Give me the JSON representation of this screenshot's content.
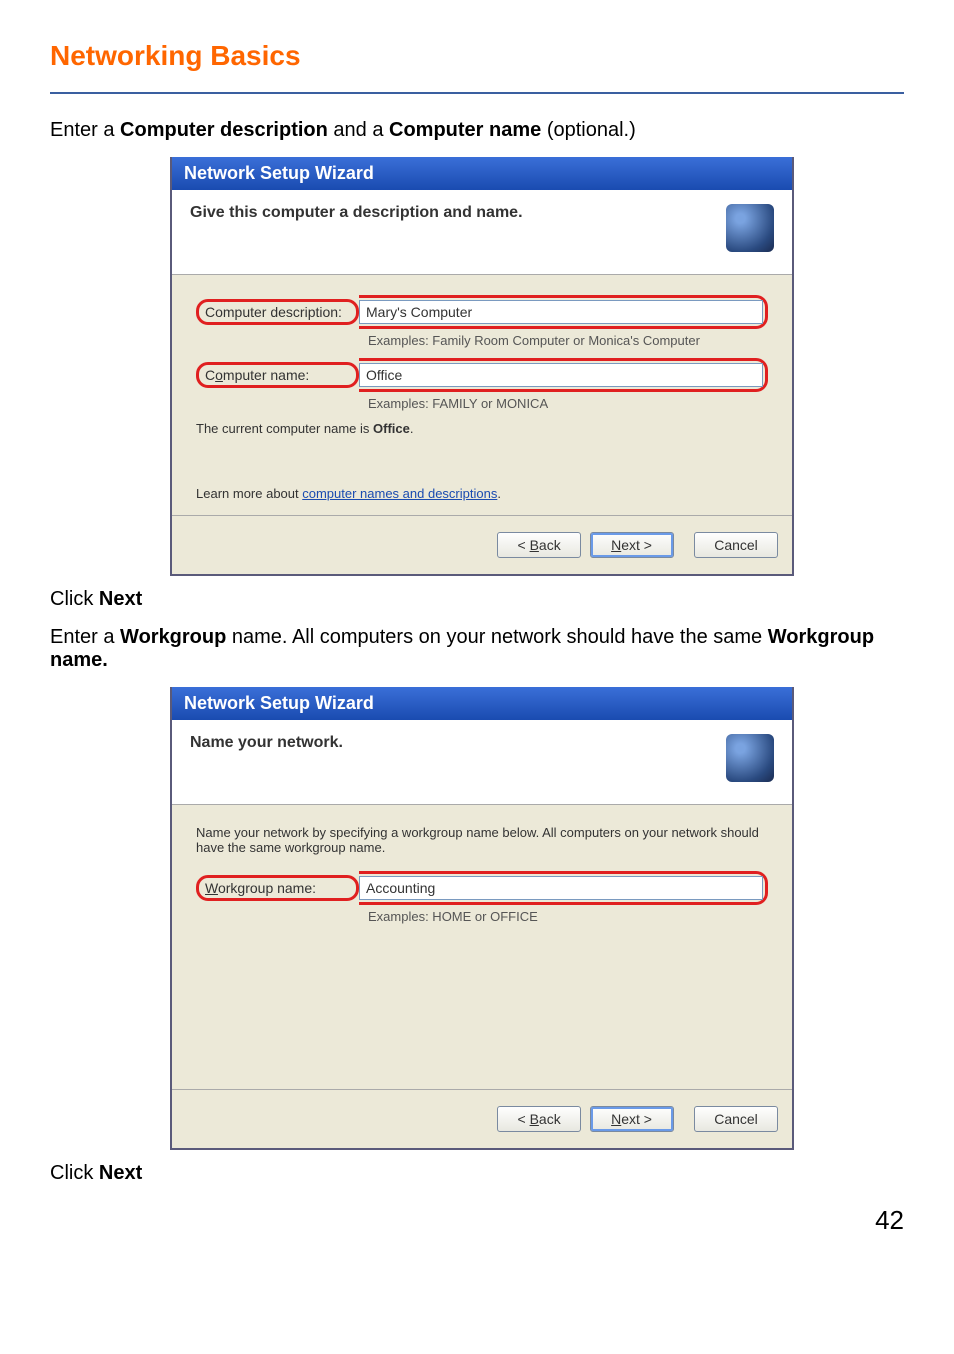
{
  "heading": "Networking Basics",
  "instr1_pre": "Enter a ",
  "instr1_b1": "Computer description",
  "instr1_mid": " and a ",
  "instr1_b2": "Computer name",
  "instr1_post": " (optional.)",
  "wiz1": {
    "title": "Network Setup Wizard",
    "header_text": "Give this computer a description and name.",
    "row1_label": "Computer description:",
    "row1_value": "Mary's Computer",
    "row1_examples": "Examples: Family Room Computer or Monica's Computer",
    "row2_label": "Computer name:",
    "row2_label_under": "o",
    "row2_value": "Office",
    "row2_examples": "Examples: FAMILY or MONICA",
    "current_sentence_pre": "The current computer name is ",
    "current_sentence_val": "Office",
    "learn_pre": "Learn more about ",
    "learn_link": "computer names and descriptions",
    "btn_back": "< Back",
    "btn_back_under": "B",
    "btn_next": "Next >",
    "btn_next_under": "N",
    "btn_cancel": "Cancel"
  },
  "click_next": "Click ",
  "click_next_b": "Next",
  "instr2_pre": "Enter a ",
  "instr2_b1": "Workgroup",
  "instr2_mid": " name.  All computers on your network should have the same ",
  "instr2_b2": "Workgroup name.",
  "wiz2": {
    "title": "Network Setup Wizard",
    "header_text": "Name your network.",
    "body_text": "Name your network by specifying a workgroup name below. All computers on your network should have the same workgroup name.",
    "row1_label": "Workgroup name:",
    "row1_label_under": "W",
    "row1_value": "Accounting",
    "row1_examples": "Examples: HOME or OFFICE",
    "btn_back": "< Back",
    "btn_back_under": "B",
    "btn_next": "Next >",
    "btn_next_under": "N",
    "btn_cancel": "Cancel"
  },
  "page_number": "42"
}
